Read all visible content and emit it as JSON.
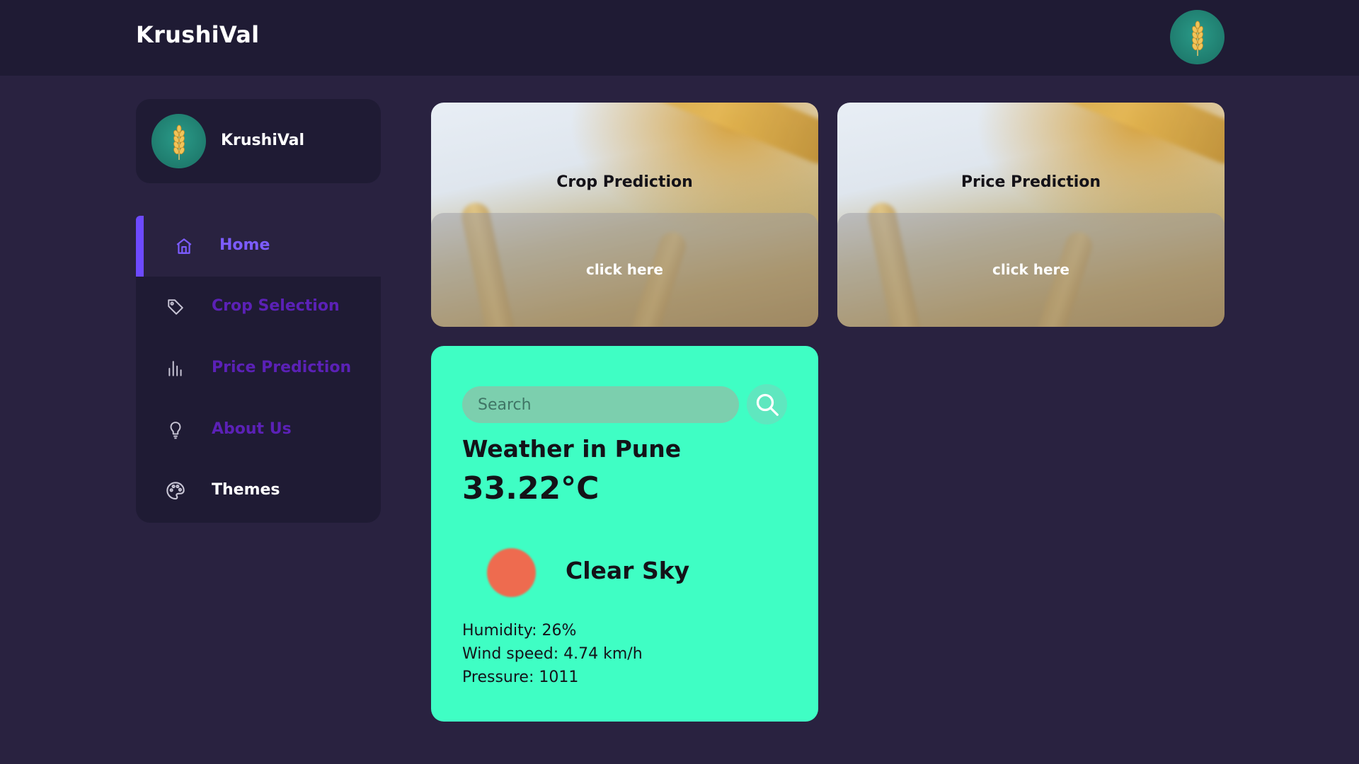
{
  "header": {
    "brand": "KrushiVal",
    "avatar_icon": "wheat-icon"
  },
  "sidebar": {
    "profile": {
      "name": "KrushiVal",
      "avatar_icon": "wheat-icon"
    },
    "items": [
      {
        "label": "Home",
        "icon": "home-icon",
        "active": true
      },
      {
        "label": "Crop Selection",
        "icon": "tag-icon"
      },
      {
        "label": "Price Prediction",
        "icon": "bar-chart-icon"
      },
      {
        "label": "About Us",
        "icon": "lightbulb-icon"
      },
      {
        "label": "Themes",
        "icon": "palette-icon"
      }
    ]
  },
  "cards": [
    {
      "title": "Crop Prediction",
      "cta": "click here"
    },
    {
      "title": "Price Prediction",
      "cta": "click here"
    }
  ],
  "weather": {
    "search_placeholder": "Search",
    "city_line": "Weather in Pune",
    "temperature": "33.22°C",
    "condition": "Clear Sky",
    "humidity": "Humidity: 26%",
    "wind": "Wind speed: 4.74 km/h",
    "pressure": "Pressure: 1011",
    "colors": {
      "card": "#3ffec4",
      "sun": "#ee6b4f"
    }
  },
  "colors": {
    "background": "#292240",
    "panel": "#1f1b34",
    "accent": "#6d4aff",
    "menu_text": "#5b21b6"
  }
}
